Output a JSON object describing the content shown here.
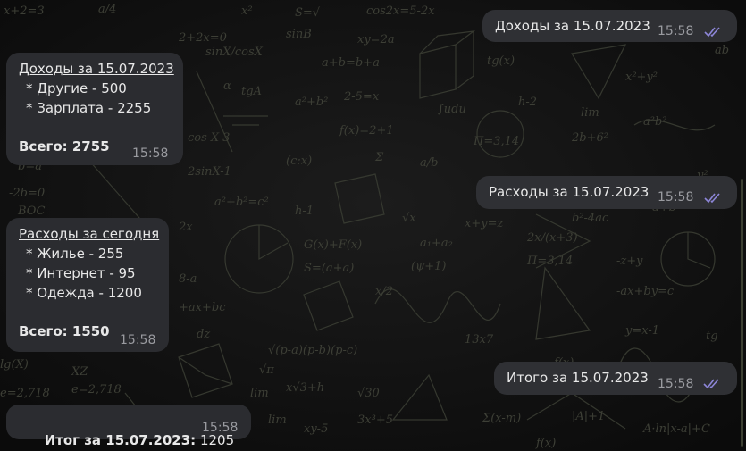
{
  "messages": {
    "m1": {
      "text": "Доходы за 15.07.2023",
      "time": "15:58"
    },
    "m2": {
      "title": "Доходы за 15.07.2023",
      "items": [
        "* Другие - 500",
        "* Зарплата - 2255"
      ],
      "total": "Всего: 2755",
      "time": "15:58"
    },
    "m3": {
      "text": "Расходы за 15.07.2023",
      "time": "15:58"
    },
    "m4": {
      "title": "Расходы за сегодня",
      "items": [
        "* Жилье - 255",
        "* Интернет - 95",
        "* Одежда - 1200"
      ],
      "total": "Всего: 1550",
      "time": "15:58"
    },
    "m5": {
      "text": "Итого за 15.07.2023",
      "time": "15:58"
    },
    "m6": {
      "label": "Итог за 15.07.2023:",
      "value": " 1205",
      "time": "15:58"
    }
  },
  "colors": {
    "bubble": "#2b2c30",
    "read_checks": "#8d86d8",
    "time": "#9a9ba0"
  },
  "icons": {
    "read_receipt": "double-check-icon"
  }
}
